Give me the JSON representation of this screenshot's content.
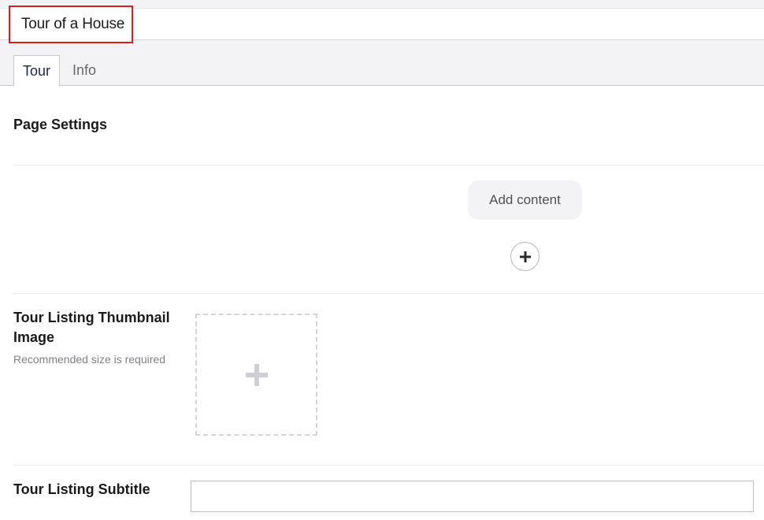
{
  "header": {
    "node_name": "Tour of a House",
    "tabs": [
      {
        "label": "Tour",
        "active": true
      },
      {
        "label": "Info",
        "active": false
      }
    ]
  },
  "sections": {
    "page_settings": {
      "title": "Page Settings"
    },
    "content": {
      "add_content_label": "Add content",
      "add_icon": "plus-icon"
    },
    "thumbnail": {
      "title_line1": "Tour Listing Thumbnail",
      "title_line2": "Image",
      "hint": "Recommended size is required",
      "add_icon": "plus-icon"
    },
    "subtitle": {
      "title": "Tour Listing Subtitle",
      "value": ""
    }
  },
  "colors": {
    "required_outline": "#d42020",
    "header_bg": "#f3f3f5"
  }
}
